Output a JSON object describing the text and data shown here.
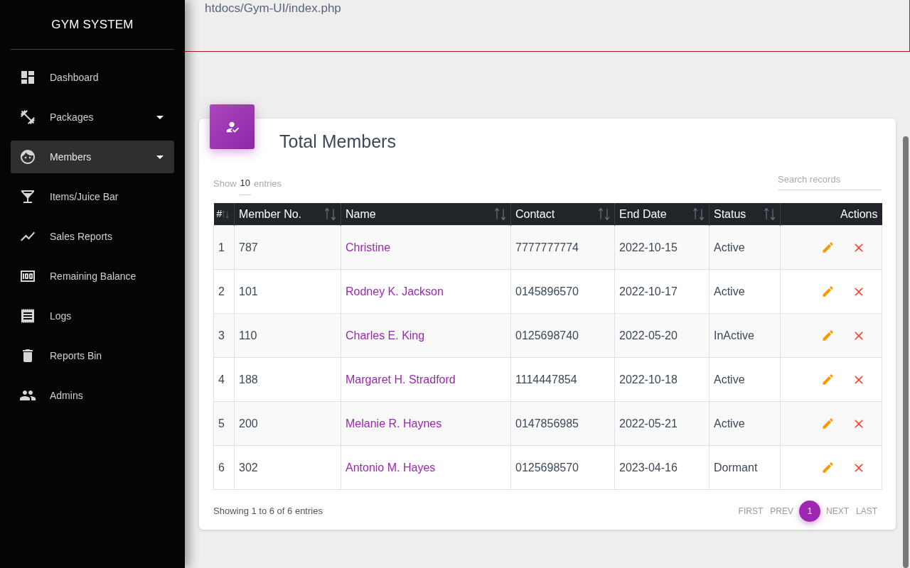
{
  "top_bar": {
    "path_text": "htdocs/Gym-UI/index.php"
  },
  "sidebar": {
    "title": "GYM SYSTEM",
    "items": [
      {
        "label": "Dashboard",
        "selected": false,
        "has_submenu": false
      },
      {
        "label": "Packages",
        "selected": false,
        "has_submenu": true
      },
      {
        "label": "Members",
        "selected": true,
        "has_submenu": true
      },
      {
        "label": "Items/Juice Bar",
        "selected": false,
        "has_submenu": false
      },
      {
        "label": "Sales Reports",
        "selected": false,
        "has_submenu": false
      },
      {
        "label": "Remaining Balance",
        "selected": false,
        "has_submenu": false
      },
      {
        "label": "Logs",
        "selected": false,
        "has_submenu": false
      },
      {
        "label": "Reports Bin",
        "selected": false,
        "has_submenu": false
      },
      {
        "label": "Admins",
        "selected": false,
        "has_submenu": false
      }
    ]
  },
  "card": {
    "title": "Total Members",
    "length_menu": {
      "prefix": "Show",
      "value": "10",
      "suffix": "entries"
    },
    "search": {
      "placeholder": "Search records"
    }
  },
  "table": {
    "columns": [
      {
        "label": "#",
        "kind": "text",
        "sortable": true
      },
      {
        "label": "Member No.",
        "kind": "text",
        "sortable": true
      },
      {
        "label": "Name",
        "kind": "link",
        "sortable": true
      },
      {
        "label": "Contact",
        "kind": "text",
        "sortable": true
      },
      {
        "label": "End Date",
        "kind": "text",
        "sortable": true
      },
      {
        "label": "Status",
        "kind": "text",
        "sortable": true
      },
      {
        "label": "Actions",
        "kind": "actions",
        "sortable": false
      }
    ],
    "rows": [
      {
        "cells": [
          "1",
          "787",
          "Christine",
          "7777777774",
          "2022-10-15",
          "Active"
        ]
      },
      {
        "cells": [
          "2",
          "101",
          "Rodney K. Jackson",
          "0145896570",
          "2022-10-17",
          "Active"
        ]
      },
      {
        "cells": [
          "3",
          "110",
          "Charles E. King",
          "0125698740",
          "2022-05-20",
          "InActive"
        ]
      },
      {
        "cells": [
          "4",
          "188",
          "Margaret H. Stradford",
          "1114447854",
          "2022-10-18",
          "Active"
        ]
      },
      {
        "cells": [
          "5",
          "200",
          "Melanie R. Haynes",
          "0147856985",
          "2022-05-21",
          "Active"
        ]
      },
      {
        "cells": [
          "6",
          "302",
          "Antonio M. Hayes",
          "0125698570",
          "2023-04-16",
          "Dormant"
        ]
      }
    ]
  },
  "info": "Showing 1 to 6 of 6 entries",
  "pagination": [
    {
      "label": "FIRST",
      "selected": false
    },
    {
      "label": "PREV",
      "selected": false
    },
    {
      "label": "1",
      "selected": true
    },
    {
      "label": "NEXT",
      "selected": false
    },
    {
      "label": "LAST",
      "selected": false
    }
  ]
}
